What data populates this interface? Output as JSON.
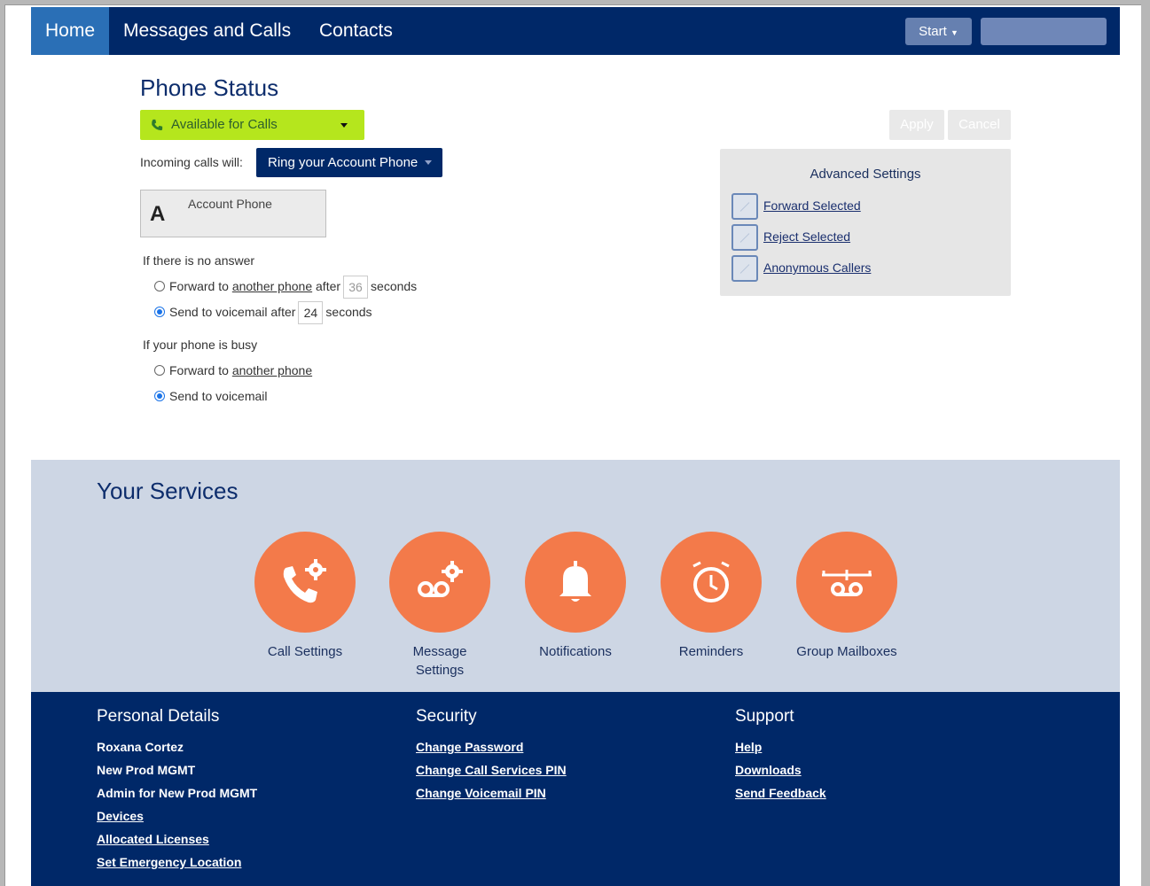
{
  "nav": {
    "tabs": [
      {
        "label": "Home"
      },
      {
        "label": "Messages and Calls"
      },
      {
        "label": "Contacts"
      }
    ],
    "start_label": "Start"
  },
  "phone_status": {
    "title": "Phone Status",
    "status_label": "Available for Calls",
    "status_color": "#b5e61d",
    "apply_label": "Apply",
    "cancel_label": "Cancel",
    "incoming_label": "Incoming calls will:",
    "ring_label": "Ring your Account Phone",
    "account_letter": "A",
    "account_name": "Account Phone",
    "no_answer": {
      "heading": "If there is no answer",
      "forward_prefix": "Forward to",
      "forward_link": "another phone",
      "forward_after": "after",
      "forward_seconds": "36",
      "seconds_label": "seconds",
      "forward_selected": false,
      "voicemail_prefix": "Send to voicemail after",
      "voicemail_seconds": "24",
      "voicemail_selected": true
    },
    "busy": {
      "heading": "If your phone is busy",
      "forward_prefix": "Forward to",
      "forward_link": "another phone",
      "forward_selected": false,
      "voicemail_label": "Send to voicemail",
      "voicemail_selected": true
    }
  },
  "advanced": {
    "title": "Advanced Settings",
    "items": [
      {
        "label": "Forward Selected"
      },
      {
        "label": "Reject Selected"
      },
      {
        "label": "Anonymous Callers"
      }
    ]
  },
  "services": {
    "title": "Your Services",
    "accent": "#f37a4a",
    "items": [
      {
        "label": "Call Settings",
        "icon": "phone-gear-icon"
      },
      {
        "label": "Message Settings",
        "icon": "voicemail-gear-icon"
      },
      {
        "label": "Notifications",
        "icon": "bell-icon"
      },
      {
        "label": "Reminders",
        "icon": "alarm-clock-icon"
      },
      {
        "label": "Group Mailboxes",
        "icon": "group-mailbox-icon"
      }
    ]
  },
  "footer": {
    "personal": {
      "title": "Personal Details",
      "name": "Roxana Cortez",
      "org": "New Prod MGMT",
      "role": "Admin for New Prod MGMT",
      "links": [
        "Devices",
        "Allocated Licenses",
        "Set Emergency Location"
      ]
    },
    "security": {
      "title": "Security",
      "links": [
        "Change Password",
        "Change Call Services PIN",
        "Change Voicemail PIN"
      ]
    },
    "support": {
      "title": "Support",
      "links": [
        "Help",
        "Downloads",
        "Send Feedback"
      ]
    }
  }
}
